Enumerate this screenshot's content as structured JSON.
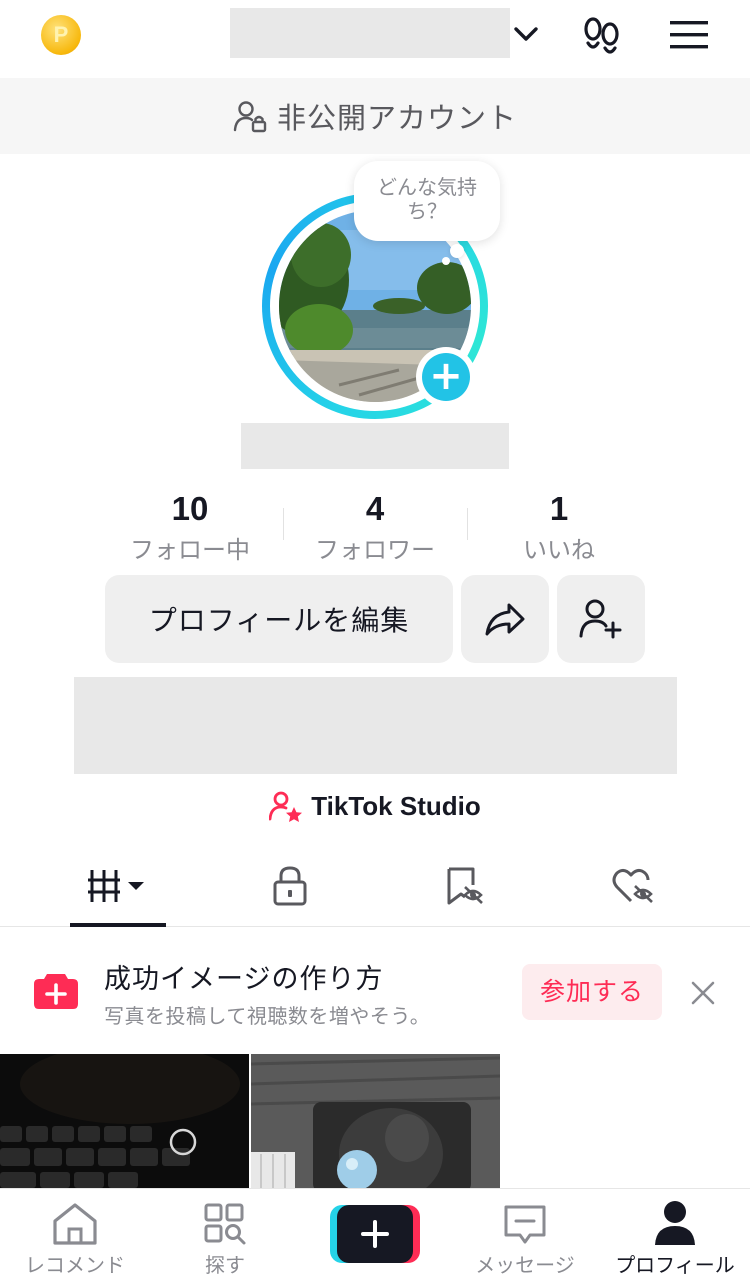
{
  "header": {
    "coin_icon": "coin-icon",
    "coin_letter": "P",
    "username": "",
    "chevron_icon": "chevron-down-icon",
    "footprint_icon": "footprint-icon",
    "menu_icon": "hamburger-menu-icon"
  },
  "private_banner": {
    "label": "非公開アカウント",
    "icon": "private-user-lock-icon"
  },
  "avatar": {
    "thought_bubble": "どんな気持ち？",
    "add_icon": "plus-icon",
    "ring_color": "#25d3e8"
  },
  "profile": {
    "name": ""
  },
  "stats": [
    {
      "value": "10",
      "label": "フォロー中"
    },
    {
      "value": "4",
      "label": "フォロワー"
    },
    {
      "value": "1",
      "label": "いいね"
    }
  ],
  "buttons": {
    "edit_profile": "プロフィールを編集",
    "share_icon": "share-arrow-icon",
    "add_friend_icon": "add-user-icon"
  },
  "bio": "",
  "studio": {
    "label": "TikTok Studio",
    "icon": "user-star-icon"
  },
  "tabs": [
    {
      "name": "videos",
      "icon": "grid-bars-icon",
      "active": true
    },
    {
      "name": "private",
      "icon": "lock-icon"
    },
    {
      "name": "favorites",
      "icon": "bookmark-hidden-icon"
    },
    {
      "name": "liked",
      "icon": "heart-hidden-icon"
    }
  ],
  "promo": {
    "title": "成功イメージの作り方",
    "subtitle": "写真を投稿して視聴数を増やそう。",
    "join_label": "参加する",
    "close_icon": "close-icon",
    "accent": "#fe2c55"
  },
  "bottom_nav": [
    {
      "label": "レコメンド",
      "icon": "home-icon"
    },
    {
      "label": "探す",
      "icon": "search-grid-icon"
    },
    {
      "label": "",
      "icon": "create-plus-icon"
    },
    {
      "label": "メッセージ",
      "icon": "message-icon"
    },
    {
      "label": "プロフィール",
      "icon": "profile-icon",
      "active": true
    }
  ]
}
